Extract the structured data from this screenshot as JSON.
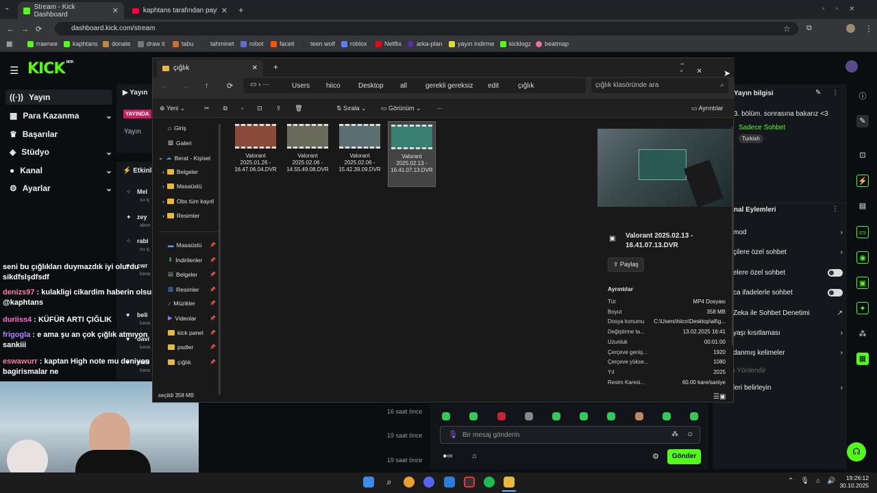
{
  "browser": {
    "tabs": [
      {
        "label": "Stream - Kick Dashboard",
        "icon": "kick-icon"
      },
      {
        "label": "kaphtans tarafından paylaşılan",
        "icon": "youtube-icon"
      }
    ],
    "url": "dashboard.kick.com/stream",
    "bookmarks": [
      "rraenee",
      "kaphtans",
      "donate",
      "draw it",
      "tabu",
      "tahminet",
      "robot",
      "faceit",
      "teen wolf",
      "roblox",
      "Netflix",
      "arka-plan",
      "yayın indirme",
      "kicklogz",
      "beatmap"
    ]
  },
  "kick": {
    "logo": "KICK",
    "logo_badge": "BETA",
    "nav": [
      {
        "label": "Yayın",
        "chevron": false
      },
      {
        "label": "Para Kazanma",
        "chevron": true
      },
      {
        "label": "Başarılar",
        "chevron": false
      },
      {
        "label": "Stüdyo",
        "chevron": true
      },
      {
        "label": "Kanal",
        "chevron": true
      },
      {
        "label": "Ayarlar",
        "chevron": true
      }
    ],
    "stream_label": "Yayın",
    "live_badge": "YAYINDA",
    "stream_sub": "Yayın",
    "activity_title": "Etkinli",
    "activity": [
      {
        "name": "Mel",
        "sub": "su iç"
      },
      {
        "name": "zey",
        "sub": "abon"
      },
      {
        "name": "rabi",
        "sub": "su iç"
      },
      {
        "name": "cwr",
        "sub": "kana"
      },
      {
        "name": "beli",
        "sub": "kana"
      },
      {
        "name": "davi",
        "sub": "kana"
      },
      {
        "name": "ewa",
        "sub": "kana"
      }
    ],
    "chat": [
      {
        "user": "",
        "text": "seni bu çığlıkları duymazdık iyi olurdu sikdfslşdfsdf",
        "color": "#ffffff"
      },
      {
        "user": "denizs97",
        "text": " : kulakligi cikardim haberin olsun @kaphtans",
        "color": "#ff7aa2"
      },
      {
        "user": "duriiss4",
        "text": " : KÜFÜR ARTI ÇIĞLIK",
        "color": "#ff6ad5"
      },
      {
        "user": "frigogla",
        "text": " : e ama şu an çok çığlık atmıyon sankiii",
        "color": "#b185ff"
      },
      {
        "user": "eswawurr",
        "text": " : kaptan High note mu deniyon bu bagirismalar ne",
        "color": "#ff7aa2"
      }
    ],
    "times": [
      "16 saat önce",
      "19 saat önce",
      "19 saat önce"
    ],
    "chat_placeholder": "Bir mesaj gönderin",
    "send": "Gönder",
    "info_title": "Yayın bilgisi",
    "info_desc": "3. bölüm. sonrasına bakarız <3",
    "info_mode": "Sadece Sohbet",
    "info_lang": "Turkish",
    "actions_title": "nal Eylemleri",
    "actions": [
      {
        "label": "mod",
        "kind": "chev"
      },
      {
        "label": "çilere özel sohbet",
        "kind": "chev"
      },
      {
        "label": "elere özel sohbet",
        "kind": "toggle"
      },
      {
        "label": "ca ifadelerle sohbet",
        "kind": "toggle"
      },
      {
        "label": "Zeka ile Sohbet Denetimi",
        "kind": "ext"
      },
      {
        "label": "yaşı kısıtlaması",
        "kind": "chev"
      },
      {
        "label": "danmış kelimeler",
        "kind": "chev"
      },
      {
        "label": "ı Yönlendir",
        "kind": "dim"
      },
      {
        "label": "leri belirleyin",
        "kind": "chev"
      }
    ]
  },
  "explorer": {
    "tab": "çığlık",
    "breadcrumb": [
      "Users",
      "hiico",
      "Desktop",
      "all",
      "gerekli gereksiz",
      "edit",
      "çığlık"
    ],
    "search_placeholder": "çığlık klasöründe ara",
    "toolbar": {
      "new": "Yeni",
      "sort": "Sırala",
      "view": "Görünüm",
      "details": "Ayrıntılar"
    },
    "sidebar": [
      {
        "label": "Giriş"
      },
      {
        "label": "Galeri"
      },
      {
        "label": "Berat - Kişisel"
      },
      {
        "label": "Belgeler"
      },
      {
        "label": "Masaüstü"
      },
      {
        "label": "Obs tüm kayıtl"
      },
      {
        "label": "Resimler"
      },
      {
        "label": "Masaüstü"
      },
      {
        "label": "İndirilenler"
      },
      {
        "label": "Belgeler"
      },
      {
        "label": "Resimler"
      },
      {
        "label": "Müzikler"
      },
      {
        "label": "Videolar"
      },
      {
        "label": "kick panel"
      },
      {
        "label": "psdler"
      },
      {
        "label": "çığlık"
      }
    ],
    "files": [
      {
        "name": "Valorant 2025.01.26 - 16.47.06.04.DVR"
      },
      {
        "name": "Valorant 2025.02.06 - 14.55.49.08.DVR"
      },
      {
        "name": "Valorant 2025.02.06 - 15.42.39.09.DVR"
      },
      {
        "name": "Valorant 2025.02.13 - 16.41.07.13.DVR"
      }
    ],
    "status": "seçildi  358 MB",
    "preview": {
      "title": "Valorant 2025.02.13 - 16.41.07.13.DVR",
      "share": "Paylaş",
      "details_title": "Ayrıntılar",
      "rows": [
        {
          "k": "Tür",
          "v": "MP4 Dosyası"
        },
        {
          "k": "Boyut",
          "v": "358 MB"
        },
        {
          "k": "Dosya konumu",
          "v": "C:\\Users\\hiico\\Desktop\\all\\g..."
        },
        {
          "k": "Değiştirme ta...",
          "v": "13.02.2025 16:41"
        },
        {
          "k": "Uzunluk",
          "v": "00:01:00"
        },
        {
          "k": "Çerçeve geniş...",
          "v": "1920"
        },
        {
          "k": "Çerçeve yükse...",
          "v": "1080"
        },
        {
          "k": "Yıl",
          "v": "2025"
        },
        {
          "k": "Resim Karesi...",
          "v": "60.00 kare/saniye"
        }
      ]
    }
  },
  "taskbar": {
    "time": "19:26:12",
    "date": "30.10.2025"
  },
  "colors": {
    "kick_green": "#53fc18",
    "explorer_bg": "#191919"
  }
}
